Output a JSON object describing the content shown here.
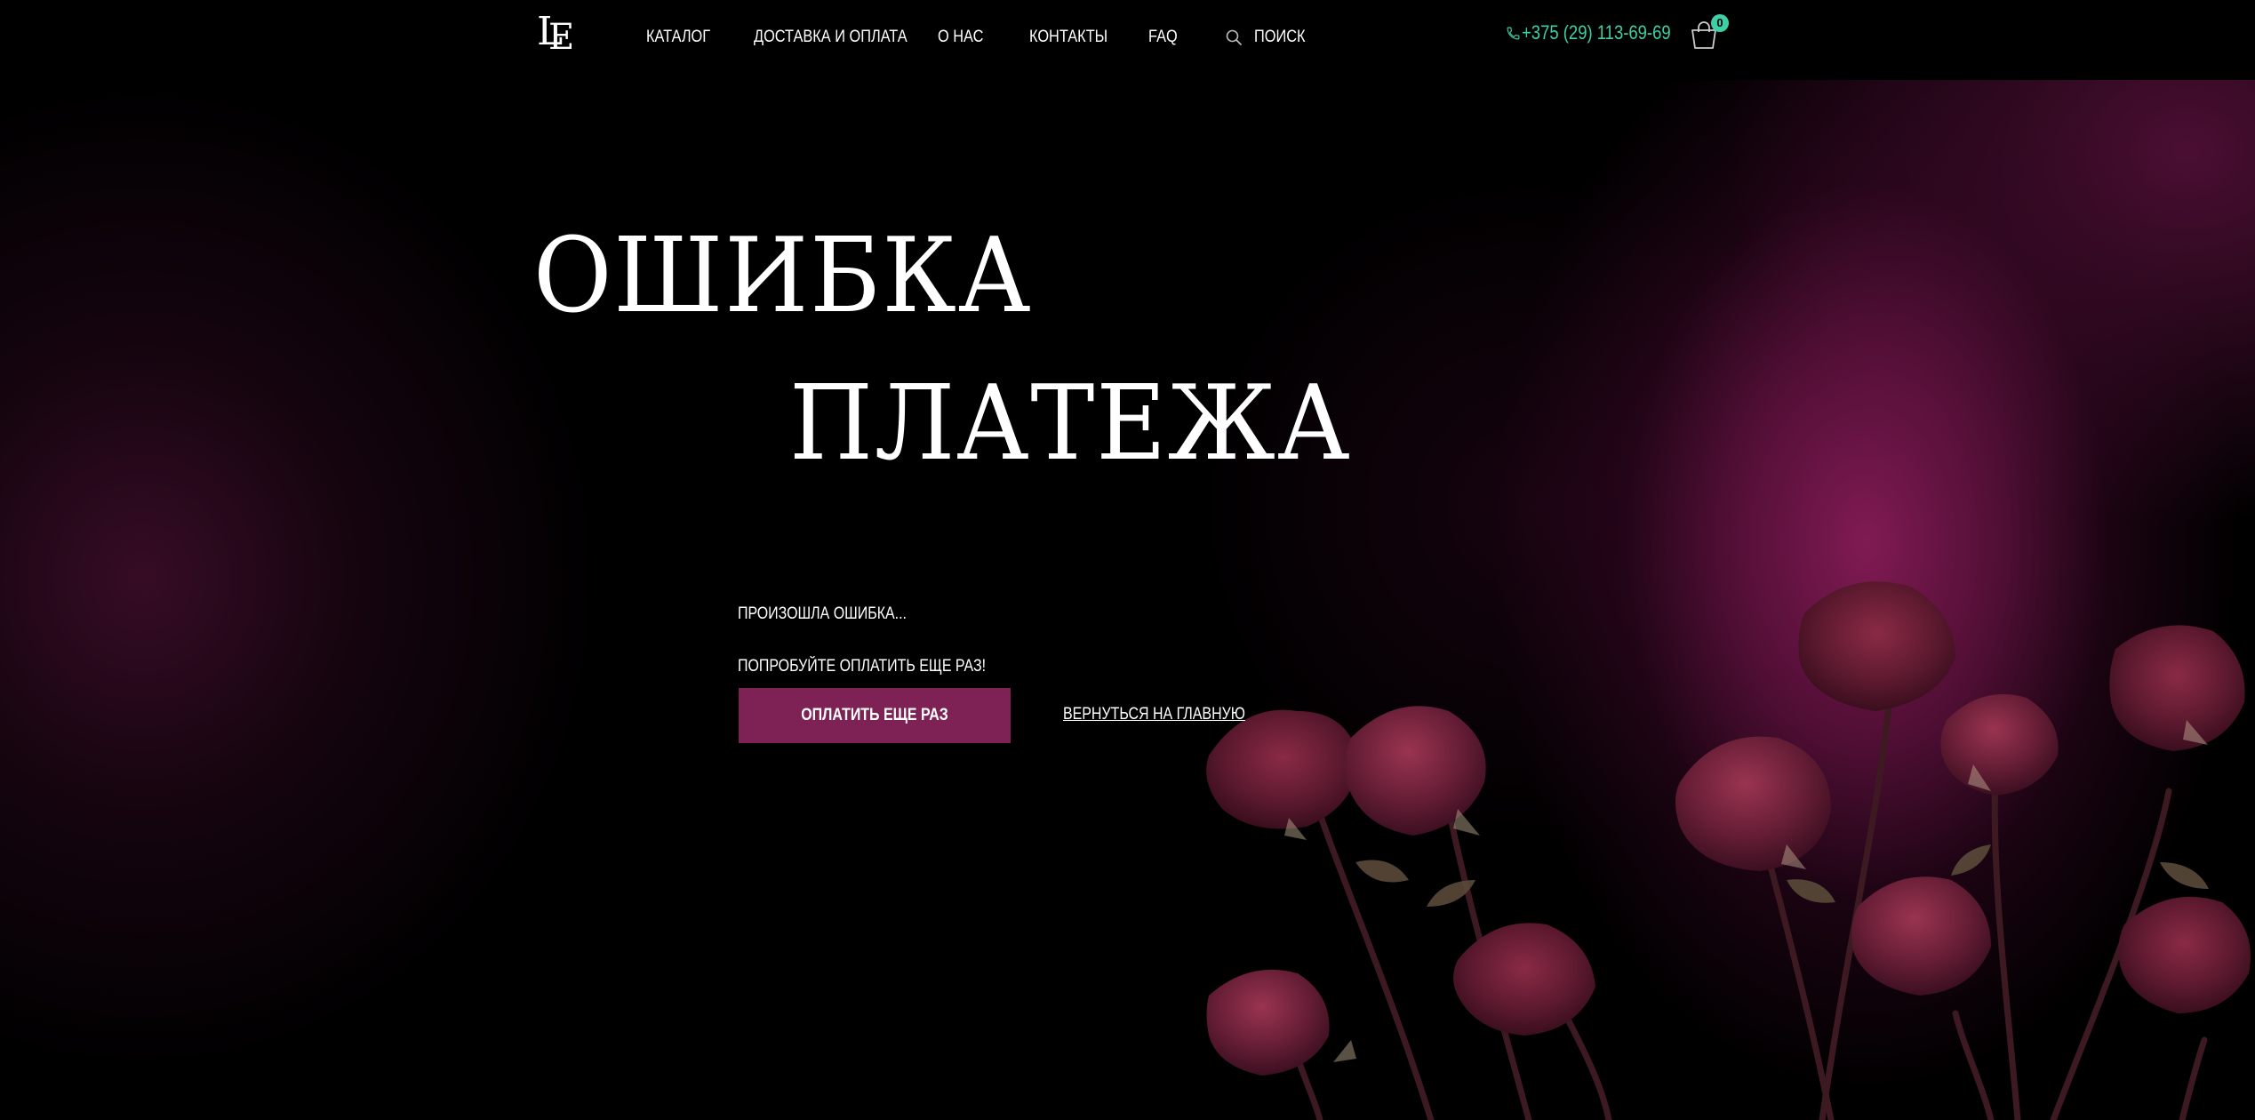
{
  "header": {
    "logo_alt": "LE",
    "nav": [
      {
        "label": "КАТАЛОГ"
      },
      {
        "label": "ДОСТАВКА И ОПЛАТА"
      },
      {
        "label": "О НАС"
      },
      {
        "label": "КОНТАКТЫ"
      },
      {
        "label": "FAQ"
      }
    ],
    "search_label": "ПОИСК",
    "search_icon": "search-icon",
    "phone": "+375 (29) 113-69-69",
    "phone_icon": "phone-icon",
    "cart_icon": "cart-icon",
    "cart_count": "0"
  },
  "hero": {
    "title_line1": "ОШИБКА",
    "title_line2": "ПЛАТЕЖА",
    "message_1": "ПРОИЗОШЛА ОШИБКА...",
    "message_2": "ПОПРОБУЙТЕ ОПЛАТИТЬ ЕЩЕ РАЗ!",
    "pay_again_label": "ОПЛАТИТЬ ЕЩЕ РАЗ",
    "home_link_label": "ВЕРНУТЬСЯ НА ГЛАВНУЮ"
  },
  "colors": {
    "background": "#000000",
    "accent": "#7e2256",
    "phone_accent": "#3ecfa6",
    "text": "#ffffff",
    "rose": "#6a1c34"
  }
}
